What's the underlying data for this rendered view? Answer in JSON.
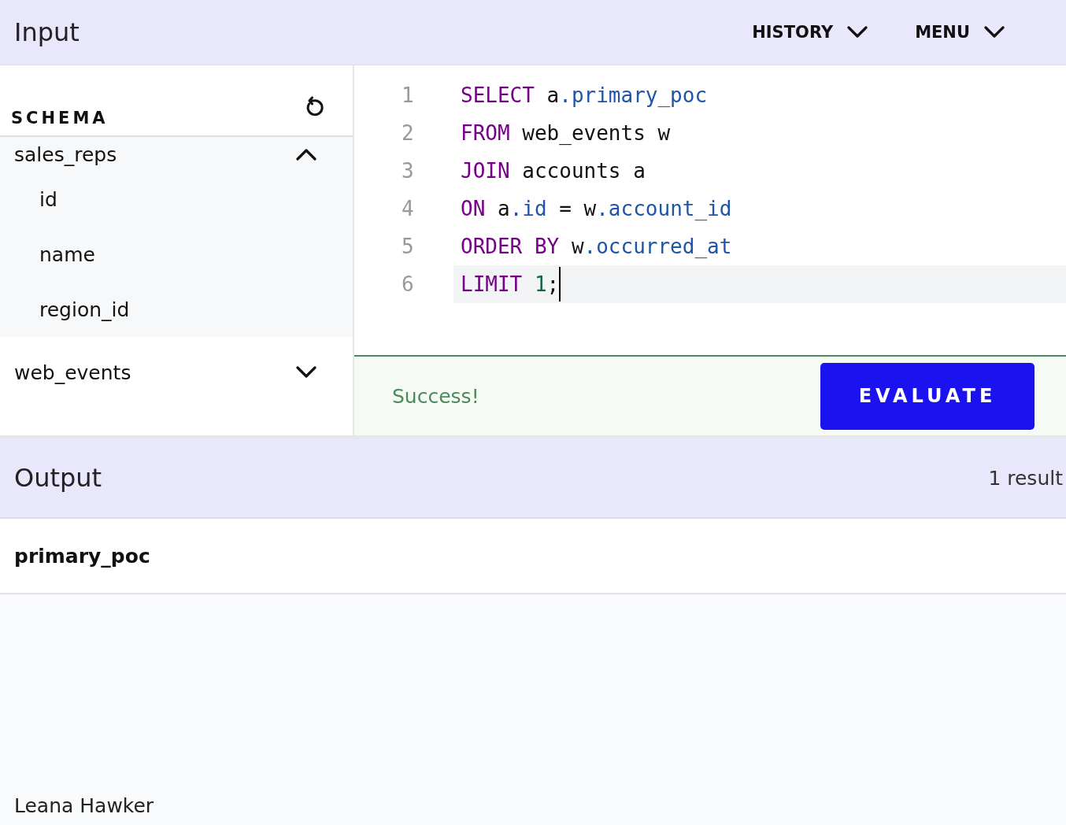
{
  "header": {
    "title": "Input",
    "menus": [
      {
        "label": "HISTORY"
      },
      {
        "label": "MENU"
      }
    ]
  },
  "schema": {
    "title": "SCHEMA",
    "tables": [
      {
        "name": "sales_reps",
        "expanded": true,
        "columns": [
          "id",
          "name",
          "region_id"
        ]
      },
      {
        "name": "web_events",
        "expanded": false
      }
    ]
  },
  "editor": {
    "lines": [
      {
        "number": "1",
        "active": false,
        "tokens": [
          {
            "kind": "keyword",
            "text": "SELECT"
          },
          {
            "kind": "plain",
            "text": " a"
          },
          {
            "kind": "member",
            "text": ".primary_poc"
          }
        ]
      },
      {
        "number": "2",
        "active": false,
        "tokens": [
          {
            "kind": "keyword",
            "text": "FROM"
          },
          {
            "kind": "plain",
            "text": " web_events w"
          }
        ]
      },
      {
        "number": "3",
        "active": false,
        "tokens": [
          {
            "kind": "keyword",
            "text": "JOIN"
          },
          {
            "kind": "plain",
            "text": " accounts a"
          }
        ]
      },
      {
        "number": "4",
        "active": false,
        "tokens": [
          {
            "kind": "keyword",
            "text": "ON"
          },
          {
            "kind": "plain",
            "text": " a"
          },
          {
            "kind": "member",
            "text": ".id"
          },
          {
            "kind": "plain",
            "text": " = w"
          },
          {
            "kind": "member",
            "text": ".account_id"
          }
        ]
      },
      {
        "number": "5",
        "active": false,
        "tokens": [
          {
            "kind": "keyword",
            "text": "ORDER BY"
          },
          {
            "kind": "plain",
            "text": " w"
          },
          {
            "kind": "member",
            "text": ".occurred_at"
          }
        ]
      },
      {
        "number": "6",
        "active": true,
        "tokens": [
          {
            "kind": "keyword",
            "text": "LIMIT"
          },
          {
            "kind": "number",
            "text": "1",
            "spaced": true
          },
          {
            "kind": "plain",
            "text": ";"
          }
        ]
      }
    ]
  },
  "status": {
    "message": "Success!",
    "button": "EVALUATE"
  },
  "output": {
    "title": "Output",
    "count": "1 result",
    "columns": [
      "primary_poc"
    ],
    "rows": [
      [
        "Leana Hawker"
      ]
    ]
  }
}
